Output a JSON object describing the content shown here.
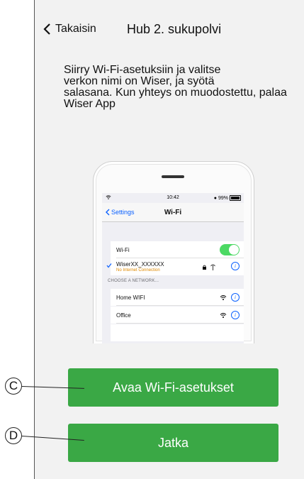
{
  "header": {
    "back_label": "Takaisin",
    "title": "Hub 2. sukupolvi"
  },
  "instructions": "Siirry Wi-Fi-asetuksiin ja valitse\nverkon nimi on Wiser, ja syötä\nsalasana. Kun yhteys on muodostettu, palaa\nWiser App",
  "phone": {
    "status_time": "10:42",
    "battery": "99%",
    "nav_back": "Settings",
    "nav_title": "Wi-Fi",
    "wifi_label": "Wi-Fi",
    "wifi_on": true,
    "connected_network": "WiserXX_XXXXXX",
    "connected_warning": "No Internet Connection",
    "section_header": "CHOOSE A NETWORK...",
    "networks": [
      "Home WIFI",
      "Office"
    ]
  },
  "buttons": {
    "open_wifi_label": "Avaa Wi-Fi-asetukset",
    "continue_label": "Jatka"
  },
  "callouts": {
    "c_label": "C",
    "d_label": "D"
  },
  "colors": {
    "button_green": "#3aa845",
    "ios_blue": "#0a60ff",
    "toggle_green": "#4cd964",
    "warning_orange": "#e08a00"
  }
}
